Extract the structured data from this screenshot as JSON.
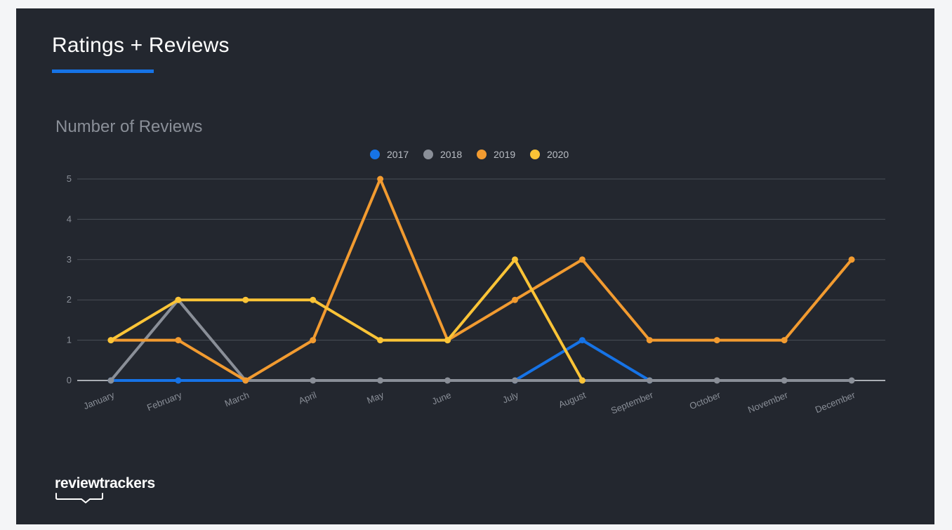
{
  "header": {
    "title": "Ratings + Reviews"
  },
  "brand": {
    "name": "reviewtrackers"
  },
  "colors": {
    "background": "#23272f",
    "accent": "#1673e6",
    "grid": "#4a4f57",
    "axis_text": "#8a8f98"
  },
  "chart_data": {
    "type": "line",
    "title": "Number of Reviews",
    "xlabel": "",
    "ylabel": "",
    "categories": [
      "January",
      "February",
      "March",
      "April",
      "May",
      "June",
      "July",
      "August",
      "September",
      "October",
      "November",
      "December"
    ],
    "ylim": [
      0,
      5
    ],
    "yticks": [
      "0",
      "1",
      "2",
      "3",
      "4",
      "5"
    ],
    "grid": true,
    "legend_position": "top-center",
    "series": [
      {
        "name": "2017",
        "color": "#1673e6",
        "values": [
          0,
          0,
          0,
          null,
          null,
          null,
          0,
          1,
          0,
          null,
          null,
          null
        ]
      },
      {
        "name": "2018",
        "color": "#8a8f98",
        "values": [
          0,
          2,
          0,
          0,
          0,
          0,
          0,
          0,
          0,
          0,
          0,
          0
        ]
      },
      {
        "name": "2019",
        "color": "#f29b30",
        "values": [
          1,
          1,
          0,
          1,
          5,
          1,
          2,
          3,
          1,
          1,
          1,
          3
        ]
      },
      {
        "name": "2020",
        "color": "#fbc437",
        "values": [
          1,
          2,
          2,
          2,
          1,
          1,
          3,
          0,
          null,
          null,
          null,
          null
        ]
      }
    ]
  }
}
